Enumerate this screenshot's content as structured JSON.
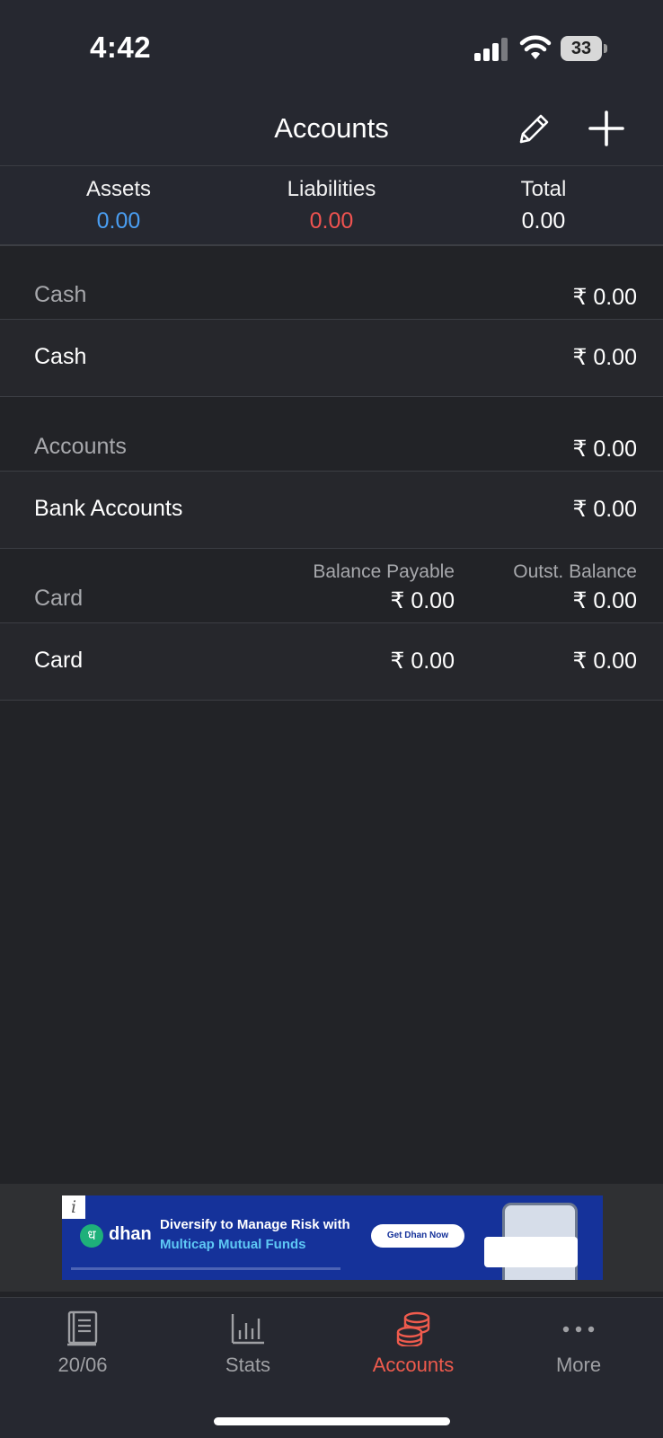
{
  "status_bar": {
    "time": "4:42",
    "battery": "33"
  },
  "nav": {
    "title": "Accounts",
    "edit_icon": "pencil-icon",
    "add_icon": "plus-icon"
  },
  "summary": {
    "assets_label": "Assets",
    "assets_value": "0.00",
    "liabilities_label": "Liabilities",
    "liabilities_value": "0.00",
    "total_label": "Total",
    "total_value": "0.00"
  },
  "groups": {
    "cash": {
      "title": "Cash",
      "amount": "₹ 0.00",
      "rows": [
        {
          "label": "Cash",
          "amount": "₹ 0.00"
        }
      ]
    },
    "accounts": {
      "title": "Accounts",
      "amount": "₹ 0.00",
      "rows": [
        {
          "label": "Bank Accounts",
          "amount": "₹ 0.00"
        }
      ]
    },
    "card": {
      "title": "Card",
      "col1_label": "Balance Payable",
      "col1_amount": "₹ 0.00",
      "col2_label": "Outst. Balance",
      "col2_amount": "₹ 0.00",
      "rows": [
        {
          "label": "Card",
          "balance_payable": "₹ 0.00",
          "outstanding": "₹ 0.00"
        }
      ]
    }
  },
  "ad": {
    "info": "i",
    "brand": "dhan",
    "logo_glyph": "ध",
    "headline": "Diversify to Manage Risk with",
    "subline": "Multicap Mutual Funds",
    "cta": "Get Dhan Now"
  },
  "tabs": [
    {
      "label": "20/06",
      "icon": "ledger-book-icon",
      "active": false
    },
    {
      "label": "Stats",
      "icon": "bar-chart-icon",
      "active": false
    },
    {
      "label": "Accounts",
      "icon": "coins-stack-icon",
      "active": true
    },
    {
      "label": "More",
      "icon": "more-dots-icon",
      "active": false
    }
  ],
  "colors": {
    "background": "#222327",
    "assets": "#4a9ef2",
    "liabilities": "#ef5350",
    "active_tab": "#ef5b4d"
  }
}
